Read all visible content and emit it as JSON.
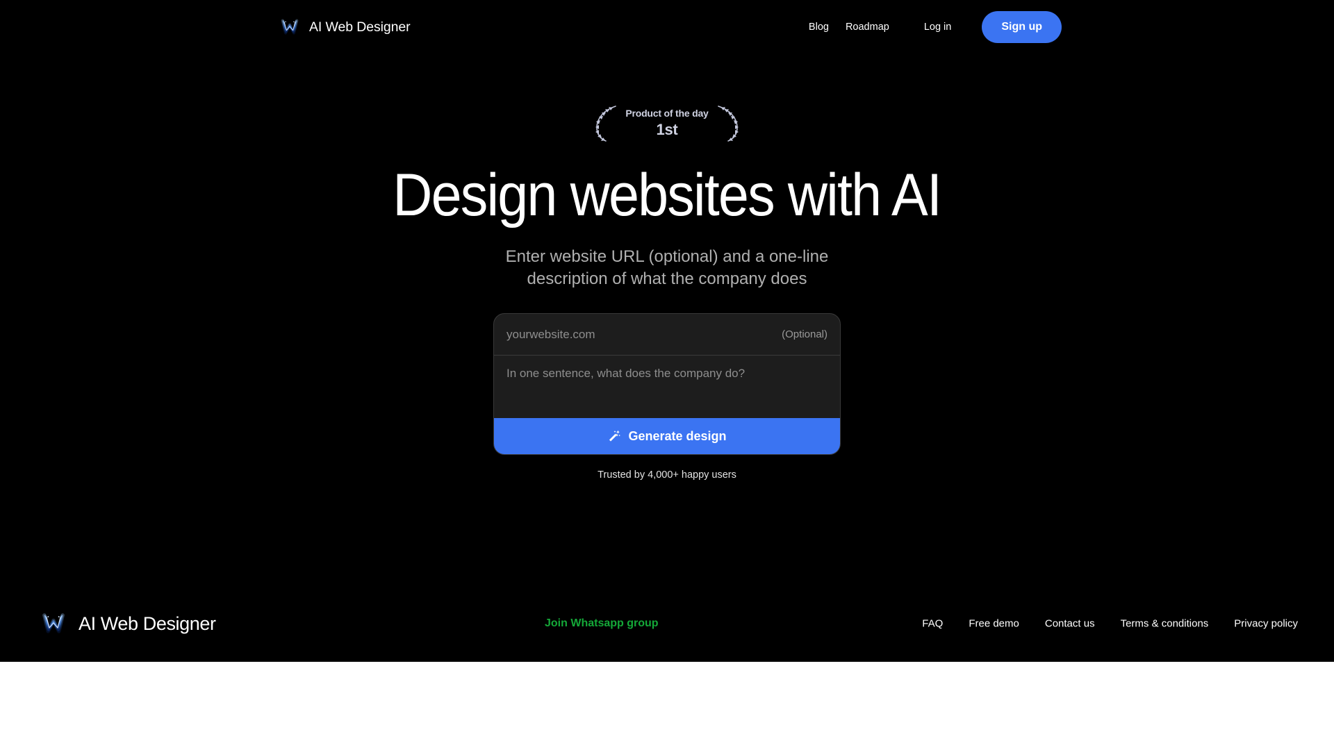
{
  "header": {
    "brand": {
      "logo_icon": "w-logo-icon",
      "name": "AI Web Designer"
    },
    "nav": [
      {
        "label": "Blog"
      },
      {
        "label": "Roadmap"
      },
      {
        "label": "Log in"
      }
    ],
    "signup_label": "Sign up"
  },
  "hero": {
    "badge": {
      "laurel_icon": "laurel-wreath-icon",
      "title": "Product of the day",
      "rank": "1st"
    },
    "title": "Design websites with AI",
    "subtitle": "Enter website URL (optional) and a one-line description of what the company does",
    "form": {
      "url_value": "",
      "url_placeholder": "yourwebsite.com",
      "optional_label": "(Optional)",
      "description_value": "",
      "description_placeholder": "In one sentence, what does the company do?",
      "generate_icon": "magic-wand-icon",
      "generate_label": "Generate design"
    },
    "trusted_text": "Trusted by 4,000+ happy users"
  },
  "footer": {
    "brand": {
      "logo_icon": "w-logo-icon",
      "name": "AI Web Designer"
    },
    "whatsapp_label": "Join Whatsapp group",
    "links": [
      {
        "label": "FAQ"
      },
      {
        "label": "Free demo"
      },
      {
        "label": "Contact us"
      },
      {
        "label": "Terms & conditions"
      },
      {
        "label": "Privacy policy"
      }
    ]
  },
  "colors": {
    "background": "#000000",
    "accent_blue": "#3b74f2",
    "whatsapp_green": "#14a838",
    "card_background": "#1d1d1d",
    "card_border": "#3a3a3a",
    "muted_text": "#b0b0b0",
    "badge_text": "#cfd2e2"
  }
}
